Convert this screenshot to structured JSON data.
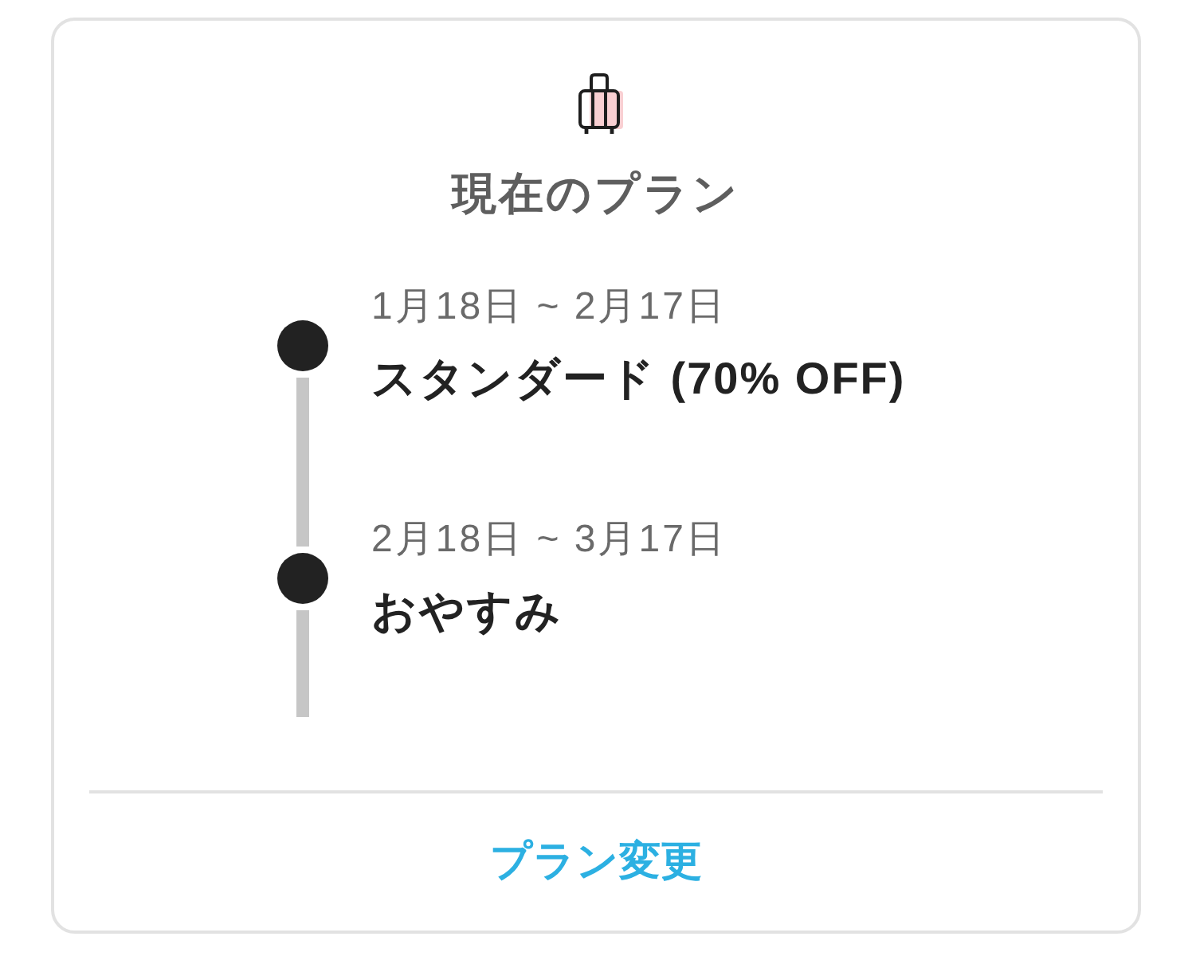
{
  "header": {
    "title": "現在のプラン"
  },
  "timeline": [
    {
      "period": "1月18日 ~ 2月17日",
      "plan": "スタンダード (70% OFF)"
    },
    {
      "period": "2月18日 ~ 3月17日",
      "plan": "おやすみ"
    }
  ],
  "footer": {
    "action": "プラン変更"
  }
}
